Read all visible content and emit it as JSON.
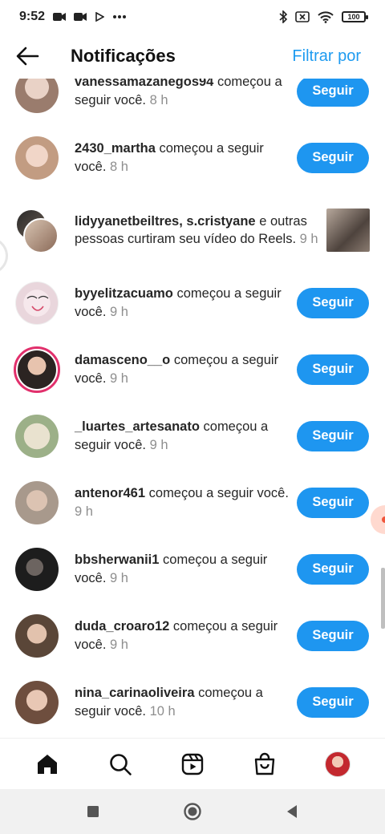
{
  "status_bar": {
    "time": "9:52",
    "battery": "100"
  },
  "header": {
    "title": "Notificações",
    "filter_label": "Filtrar por"
  },
  "notifications": [
    {
      "username": "vanessamazanegos94",
      "action": "começou a seguir você.",
      "time": "8 h",
      "button": "Seguir",
      "avatar_color": "#b89a8c"
    },
    {
      "username": "2430_martha",
      "action": "começou a seguir você.",
      "time": "8 h",
      "button": "Seguir",
      "avatar_color": "#c9a58f"
    },
    {
      "username": "lidyyanetbeiltres, s.cristyane",
      "action": "e outras pessoas curtiram seu vídeo do Reels.",
      "time": "9 h"
    },
    {
      "username": "byyelitzacuamo",
      "action": "começou a seguir você.",
      "time": "9 h",
      "button": "Seguir",
      "avatar_color": "#f3ecee"
    },
    {
      "username": "damasceno__o",
      "action": "começou a seguir você.",
      "time": "9 h",
      "button": "Seguir",
      "avatar_color": "#3b3230"
    },
    {
      "username": "_luartes_artesanato",
      "action": "começou a seguir você.",
      "time": "9 h",
      "button": "Seguir",
      "avatar_color": "#a7b894"
    },
    {
      "username": "antenor461",
      "action": "começou a seguir você.",
      "time": "9 h",
      "button": "Seguir",
      "avatar_color": "#bba99a"
    },
    {
      "username": "bbsherwanii1",
      "action": "começou a seguir você.",
      "time": "9 h",
      "button": "Seguir",
      "avatar_color": "#2b2b2b"
    },
    {
      "username": "duda_croaro12",
      "action": "começou a seguir você.",
      "time": "9 h",
      "button": "Seguir",
      "avatar_color": "#6e5a4c"
    },
    {
      "username": "nina_carinaoliveira",
      "action": "começou a seguir você.",
      "time": "10 h",
      "button": "Seguir",
      "avatar_color": "#8c6a58"
    }
  ],
  "bottom_nav": [
    "home-icon",
    "search-icon",
    "reels-icon",
    "shop-icon",
    "profile-avatar"
  ],
  "colors": {
    "accent": "#1e96f0",
    "story_ring": "#e1306c"
  }
}
